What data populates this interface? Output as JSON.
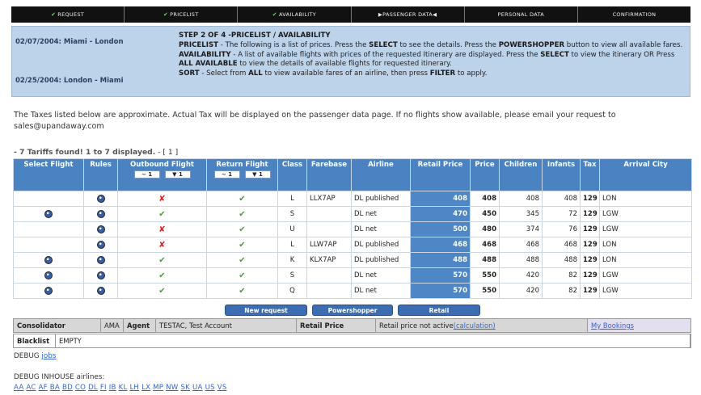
{
  "steps": [
    {
      "label": "REQUEST",
      "done": true
    },
    {
      "label": "PRICELIST",
      "done": true
    },
    {
      "label": "AVAILABILITY",
      "done": true
    },
    {
      "label": "PASSENGER DATA",
      "done": false,
      "current": true
    },
    {
      "label": "PERSONAL DATA",
      "done": false
    },
    {
      "label": "CONFIRMATION",
      "done": false
    }
  ],
  "intro": {
    "trip1": "02/07/2004: Miami - London",
    "trip2": "02/25/2004: London - Miami",
    "step_title": "STEP 2 OF 4 -PRICELIST / AVAILABILITY",
    "pricelist_label": "PRICELIST",
    "pricelist_text1": " - The following is a list of prices. Press the ",
    "select_word": "SELECT",
    "pricelist_text2": " to see the details. Press the ",
    "powershopper_word": "POWERSHOPPER",
    "pricelist_text3": " button to view all available fares.",
    "availability_label": "AVAILABILITY",
    "availability_text1": " - A list of available flights with prices of the requested Itinerary are displayed. Press the ",
    "availability_text2": " to view the itinerary OR Press ",
    "all_available_word": "ALL AVAILABLE",
    "availability_text3": " to view the details of available flights for requested itinerary.",
    "sort_label": "SORT",
    "sort_text1": " - Select from ",
    "all_word": "ALL",
    "sort_text2": " to view available fares of an airline, then press ",
    "filter_word": "FILTER",
    "sort_text3": " to apply."
  },
  "tax_note": "The Taxes listed below are approximate. Actual Tax will be displayed on the passenger data page. If no flights show available, please email your request to sales@upandaway.com",
  "found": {
    "prefix": "- 7 Tariffs found! 1 to 7 displayed.",
    "pages": " - [ 1 ]"
  },
  "columns": [
    "Select Flight",
    "Rules",
    "Outbound Flight",
    "Return Flight",
    "Class",
    "Farebase",
    "Airline",
    "Retail Price",
    "Price",
    "Children",
    "Infants",
    "Tax",
    "Arrival City"
  ],
  "sort_buttons": {
    "a": "~ 1",
    "b": "▼ 1"
  },
  "rows": [
    {
      "select": false,
      "rules": true,
      "out": false,
      "ret": true,
      "cls": "L",
      "fare": "LLX7AP",
      "airline": "DL published",
      "retail": "408",
      "price": "408",
      "children": "408",
      "infants": "408",
      "tax": "129",
      "city": "LON"
    },
    {
      "select": true,
      "rules": true,
      "out": true,
      "ret": true,
      "cls": "S",
      "fare": "",
      "airline": "DL net",
      "retail": "470",
      "price": "450",
      "children": "345",
      "infants": "72",
      "tax": "129",
      "city": "LGW"
    },
    {
      "select": false,
      "rules": true,
      "out": false,
      "ret": true,
      "cls": "U",
      "fare": "",
      "airline": "DL net",
      "retail": "500",
      "price": "480",
      "children": "374",
      "infants": "76",
      "tax": "129",
      "city": "LGW"
    },
    {
      "select": false,
      "rules": true,
      "out": false,
      "ret": true,
      "cls": "L",
      "fare": "LLW7AP",
      "airline": "DL published",
      "retail": "468",
      "price": "468",
      "children": "468",
      "infants": "468",
      "tax": "129",
      "city": "LON"
    },
    {
      "select": true,
      "rules": true,
      "out": true,
      "ret": true,
      "cls": "K",
      "fare": "KLX7AP",
      "airline": "DL published",
      "retail": "488",
      "price": "488",
      "children": "488",
      "infants": "488",
      "tax": "129",
      "city": "LON"
    },
    {
      "select": true,
      "rules": true,
      "out": true,
      "ret": true,
      "cls": "S",
      "fare": "",
      "airline": "DL net",
      "retail": "570",
      "price": "550",
      "children": "420",
      "infants": "82",
      "tax": "129",
      "city": "LGW"
    },
    {
      "select": true,
      "rules": true,
      "out": true,
      "ret": true,
      "cls": "Q",
      "fare": "",
      "airline": "DL net",
      "retail": "570",
      "price": "550",
      "children": "420",
      "infants": "82",
      "tax": "129",
      "city": "LGW"
    }
  ],
  "buttons": {
    "new_request": "New request",
    "powershopper": "Powershopper",
    "retail": "Retail"
  },
  "info": {
    "consolidator_label": "Consolidator",
    "consolidator_value": "AMA",
    "agent_label": "Agent",
    "agent_value": "TESTAC, Test Account",
    "retail_label": "Retail Price",
    "retail_value": "Retail price not active ",
    "calc_link": "(calculation)",
    "bookings_link": "My Bookings"
  },
  "blacklist": {
    "label": "Blacklist",
    "value": "EMPTY"
  },
  "debug": {
    "label": "DEBUG ",
    "link": "jobs"
  },
  "debug_inhouse": "DEBUG INHOUSE airlines:",
  "airlines": [
    "AA",
    "AC",
    "AF",
    "BA",
    "BD",
    "CO",
    "DL",
    "FI",
    "IB",
    "KL",
    "LH",
    "LX",
    "MP",
    "NW",
    "SK",
    "UA",
    "US",
    "VS"
  ],
  "colors": {
    "header_blue": "#4a82c2",
    "intro_bg": "#bcd3ea",
    "check": "#4a9e3a",
    "cross": "#dd2222"
  }
}
